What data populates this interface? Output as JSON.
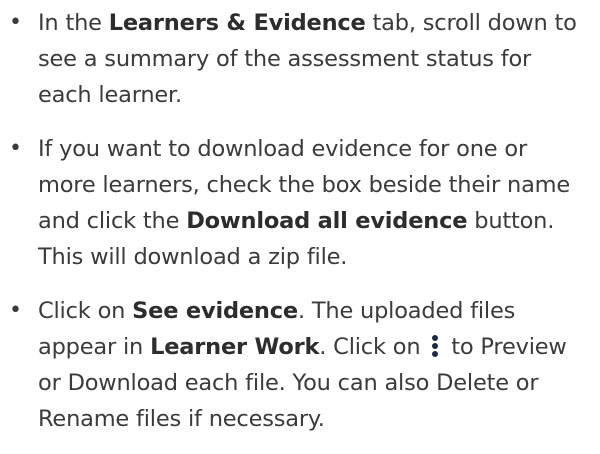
{
  "bullet_char": "•",
  "steps": [
    {
      "s1": "In the ",
      "b1": "Learners & Evidence",
      "s2": " tab, scroll down to see a summary of the assessment status for each learner."
    },
    {
      "s1": "If you want to download evidence for one or more learners, check the box beside their name and click the ",
      "b1": "Download all evidence",
      "s2": " button. This will download a zip file."
    },
    {
      "s1": "Click on ",
      "b1": "See evidence",
      "s2": ". The uploaded files appear in ",
      "b2": "Learner Work",
      "s3": ". Click on ",
      "icon": "kebab-menu-icon",
      "s4": " to Preview or Download each file. You can also Delete or Rename files if necessary."
    }
  ]
}
